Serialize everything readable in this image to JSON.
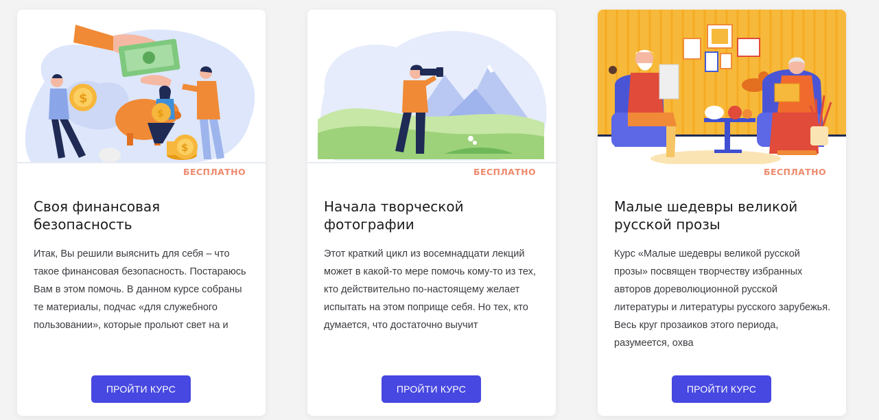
{
  "colors": {
    "accent": "#4747e1",
    "badge": "#ee8a6e",
    "title": "#1b1b1f",
    "text": "#3a3a40",
    "background": "#f3f3f4"
  },
  "courses": [
    {
      "illustration": "finance-illustration",
      "badge": "БЕСПЛАТНО",
      "title": "Своя финансовая безопасность",
      "description": "Итак, Вы решили выяснить для себя – что такое финансовая безопасность. Постараюсь Вам в этом помочь. В данном курсе собраны те материалы, подчас «для служебного пользовании», которые прольют свет на и",
      "button": "ПРОЙТИ КУРС"
    },
    {
      "illustration": "photography-illustration",
      "badge": "БЕСПЛАТНО",
      "title": "Начала творческой фотографии",
      "description": "Этот краткий цикл из восемнадцати лекций может в какой-то мере помочь кому-то из тех, кто действительно по-настоящему желает испытать на этом поприще себя. Но тех, кто думается, что достаточно выучит",
      "button": "ПРОЙТИ КУРС"
    },
    {
      "illustration": "reading-couple-illustration",
      "badge": "БЕСПЛАТНО",
      "title": "Малые шедевры великой русской прозы",
      "description": "Курс «Малые шедевры великой русской прозы» посвящен творчеству избранных авторов дореволюционной русской литературы и литературы русского зарубежья. Весь круг прозаиков этого периода, разумеется, охва",
      "button": "ПРОЙТИ КУРС"
    }
  ]
}
